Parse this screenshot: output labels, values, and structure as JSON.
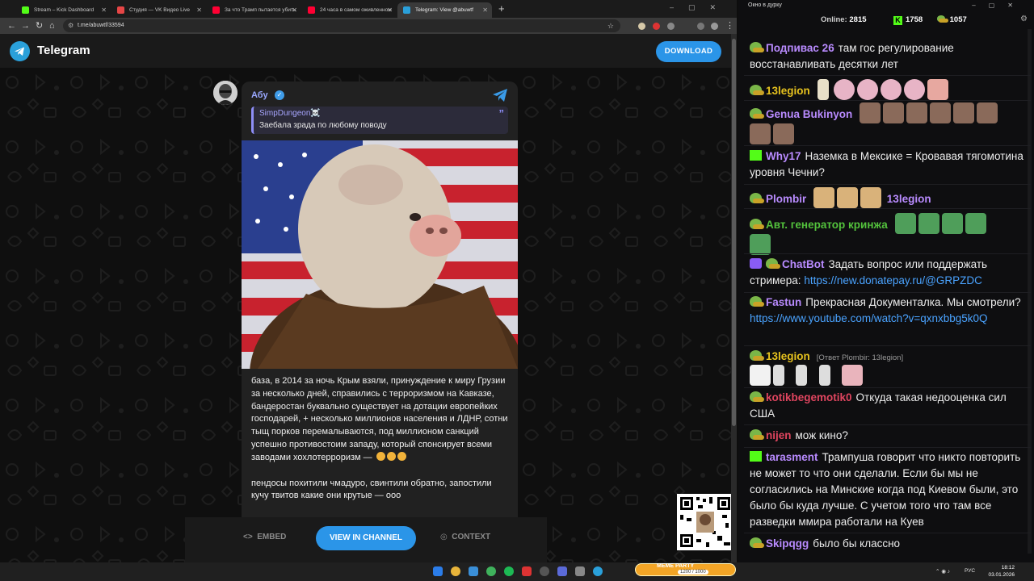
{
  "browser": {
    "tabs": [
      {
        "label": "Stream – Kick Dashboard",
        "fav_color": "#53fc18"
      },
      {
        "label": "Студия — VK Видео Live",
        "fav_color": "#e64646"
      },
      {
        "label": "За что Трамп пытается убить",
        "fav_color": "#ff0033"
      },
      {
        "label": "24 часа в самом оживленном",
        "fav_color": "#ff0033"
      },
      {
        "label": "Telegram: View @abuwtf",
        "fav_color": "#2aa0da"
      }
    ],
    "url": "t.me/abuwtf/33594"
  },
  "telegram": {
    "brand": "Telegram",
    "download_label": "DOWNLOAD",
    "channel_name": "Абу",
    "quote": {
      "author": "SimpDungeon☠️",
      "text": "Заебала зрада по любому поводу"
    },
    "post_text_1": "база, в 2014 за ночь Крым взяли, принуждение к миру Грузии за несколько дней, справились с терроризмом на Кавказе, бандеростан буквально существует на дотации европейких господарей, + несколько миллионов населения и ЛДНР, сотни тыщ порков перемалываются, под миллионом санкций успешно противостоим западу, который спонсирует всеми заводами хохлотерроризм —",
    "post_text_2": "пендосы похитили чмадуро, свинтили обратно, запостили кучу твитов какие они крутые — ооо",
    "embed_label": "EMBED",
    "view_label": "VIEW IN CHANNEL",
    "context_label": "CONTEXT"
  },
  "chat": {
    "window_title": "Окно в дурку",
    "online_label": "Online:",
    "online_count": "2815",
    "kick_count": "1758",
    "vk_count": "1057",
    "messages": [
      {
        "user": "Подпивас 26",
        "color": "#b98bff",
        "badge": "pepe",
        "text": "там гос регулирование восстанавливать десятки лет"
      },
      {
        "user": "13legion",
        "color": "#e6c21e",
        "badge": "pepe",
        "text": ""
      },
      {
        "user": "Genua Bukinyon",
        "color": "#b98bff",
        "badge": "pepe",
        "text": ""
      },
      {
        "user": "Why17",
        "color": "#b98bff",
        "badge": "kick",
        "text": "Наземка в Мексике = Кровавая тягомотина уровня Чечни?"
      },
      {
        "user": "Plombir",
        "color": "#b98bff",
        "badge": "pepe",
        "text": "",
        "mention": "13legion"
      },
      {
        "user": "Авт. генератор кринжа",
        "color": "#53c23c",
        "badge": "pepe",
        "text": ""
      },
      {
        "user": "ChatBot",
        "color": "#b98bff",
        "badge": "bot",
        "text": "Задать вопрос или поддержать стримера:",
        "link": "https://new.donatepay.ru/@GRPZDC"
      },
      {
        "user": "Fastun",
        "color": "#b98bff",
        "badge": "pepe",
        "text": "Прекрасная Документалка. Мы смотрели?",
        "link": "https://www.youtube.com/watch?v=qxnxbbg5k0Q"
      },
      {
        "user": "13legion",
        "color": "#e6c21e",
        "badge": "pepe",
        "reply": "[Ответ Plombir: 13legion]"
      },
      {
        "user": "kotikbegemotik0",
        "color": "#e0455f",
        "badge": "pepe",
        "text": "Откуда такая недооценка сил США"
      },
      {
        "user": "nijen",
        "color": "#e0455f",
        "badge": "pepe",
        "text": "мож кино?"
      },
      {
        "user": "tarasment",
        "color": "#b98bff",
        "badge": "kick",
        "text": "Трампуша говорит что никто повторить не может то что они сделали. Если бы мы не согласились на Минские когда под Киевом были, это было бы куда лучше. С учетом того что там все разведки ммира работали на Куев"
      },
      {
        "user": "Skipqgg",
        "color": "#b98bff",
        "badge": "pepe",
        "text": "было бы классно"
      }
    ]
  },
  "taskbar": {
    "meme_title": "MEME PARTY",
    "meme_value": "1200 / 1000",
    "lang": "РУС",
    "time": "18:12",
    "date": "03.01.2026"
  }
}
